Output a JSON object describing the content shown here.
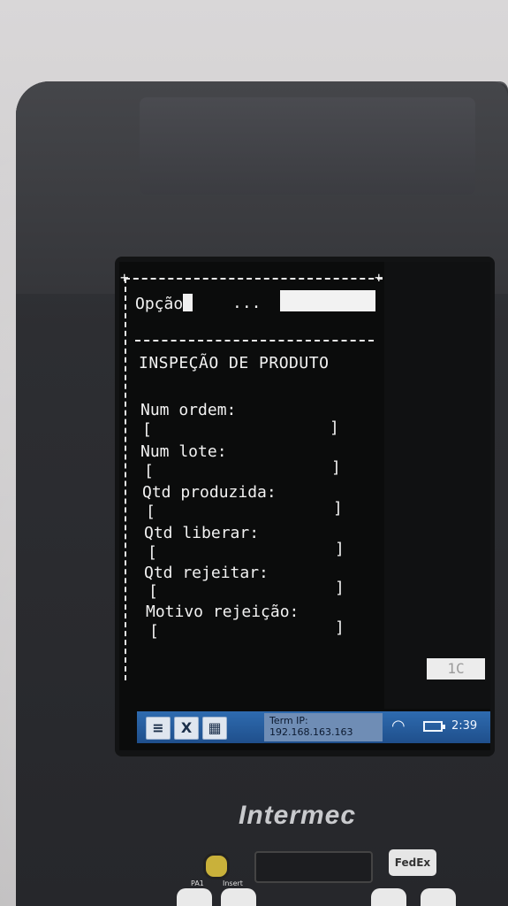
{
  "terminal": {
    "option_label": "Opção",
    "dots": "...",
    "title": "INSPEÇÃO DE PRODUTO",
    "fields": [
      {
        "label": "Num ordem:",
        "open": "[",
        "close": "]"
      },
      {
        "label": "Num lote:",
        "open": "[",
        "close": "]"
      },
      {
        "label": "Qtd produzida:",
        "open": "[",
        "close": "]"
      },
      {
        "label": "Qtd liberar:",
        "open": "[",
        "close": "]"
      },
      {
        "label": "Qtd rejeitar:",
        "open": "[",
        "close": "]"
      },
      {
        "label": "Motivo rejeição:",
        "open": "[",
        "close": "]"
      }
    ],
    "mode_indicator": "1C"
  },
  "taskbar": {
    "btn_menu": "≡",
    "btn_close": "X",
    "btn_keyboard": "▦",
    "ip_label": "Term IP:",
    "ip_value": "192.168.163.163",
    "time": "2:39"
  },
  "device": {
    "brand": "Intermec",
    "fedex": "FedEx",
    "key_pa1": "PA1",
    "key_insert": "Insert"
  },
  "colors": {
    "taskbar": "#2e6bb0",
    "screen_bg": "#0b0c0c",
    "text": "#f2f2f2"
  }
}
